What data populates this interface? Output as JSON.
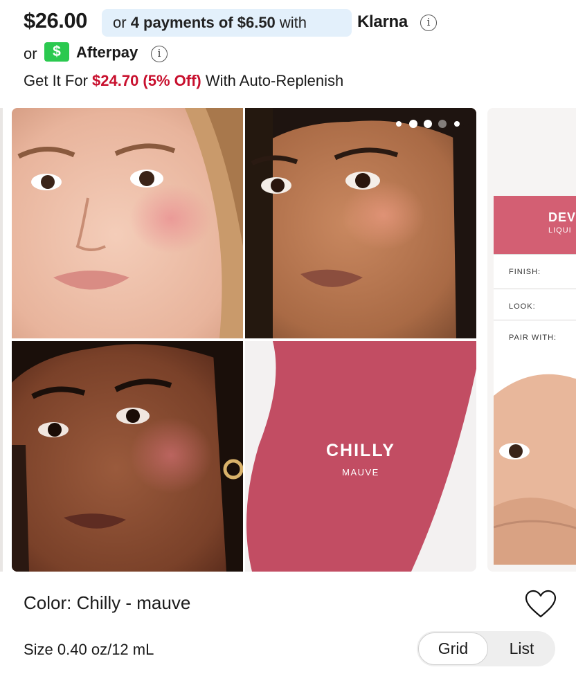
{
  "price": {
    "amount": "$26.00",
    "klarna": {
      "prefix": "or ",
      "installments": "4 payments of $6.50",
      "suffix": " with",
      "brand": "Klarna",
      "info_icon": "info-circle-icon"
    },
    "afterpay": {
      "prefix": "or",
      "badge_icon": "dollar-sign-icon",
      "badge_symbol": "$",
      "brand": "Afterpay",
      "info_icon": "info-circle-icon",
      "badge_color": "#2bc94f"
    },
    "auto_replenish": {
      "prefix": "Get It For ",
      "discount_price": "$24.70 (5% Off)",
      "suffix": " With Auto-Replenish",
      "accent_color": "#c8102e"
    }
  },
  "gallery": {
    "pagination": {
      "total": 5,
      "active_index": 3
    },
    "swatch": {
      "shade_name": "CHILLY",
      "shade_family": "MAUVE",
      "color": "#c24d63"
    },
    "next_card": {
      "title": "DEV",
      "subtitle": "LIQUI",
      "header_color": "#d35f73",
      "rows": [
        "FINISH:",
        "LOOK:",
        "PAIR WITH:"
      ]
    }
  },
  "product": {
    "color_label": "Color: Chilly - mauve",
    "size_label": "Size 0.40 oz/12 mL",
    "favorite_icon": "heart-outline-icon"
  },
  "view_toggle": {
    "options": [
      "Grid",
      "List"
    ],
    "selected": "Grid"
  }
}
